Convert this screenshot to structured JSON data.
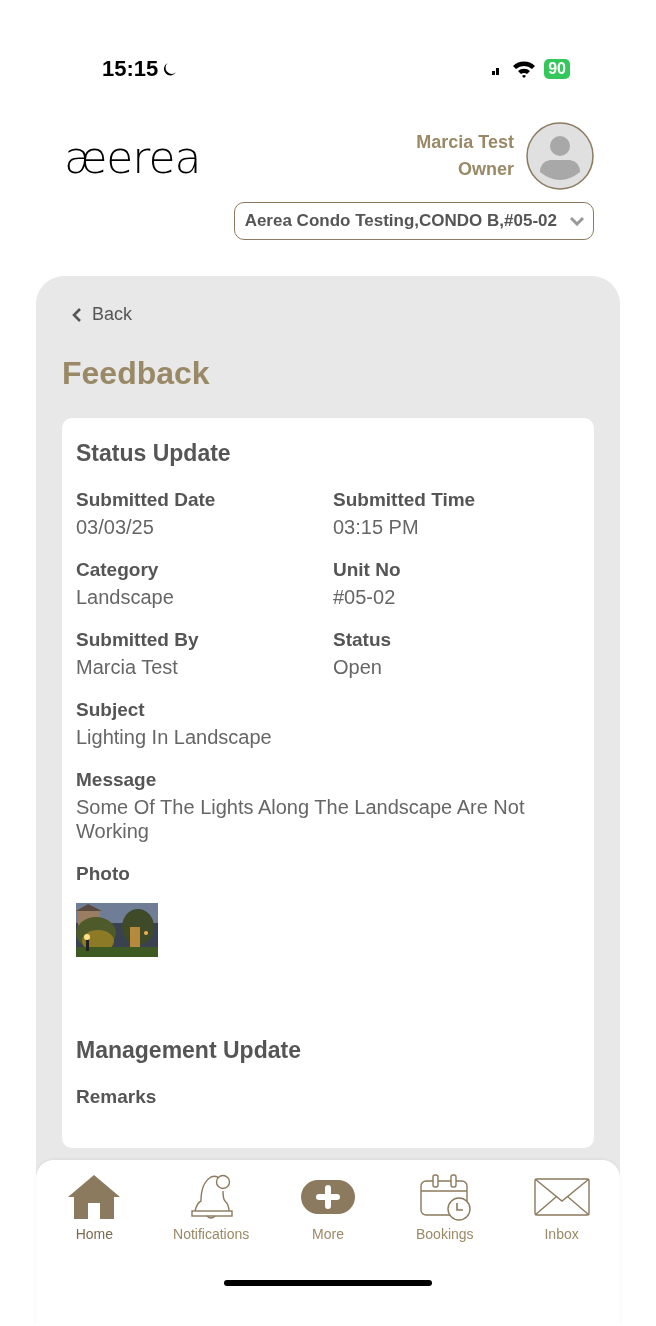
{
  "status_bar": {
    "time": "15:15",
    "battery": "90"
  },
  "header": {
    "logo": "æerea",
    "user_name": "Marcia Test",
    "user_role": "Owner",
    "unit_selector": "Aerea Condo Testing,CONDO B,#05-02"
  },
  "back": "Back",
  "page_title": "Feedback",
  "status_update": {
    "title": "Status Update",
    "fields": [
      {
        "label": "Submitted Date",
        "value": "03/03/25",
        "kind": "half"
      },
      {
        "label": "Submitted Time",
        "value": "03:15 PM",
        "kind": "half"
      },
      {
        "label": "Category",
        "value": "Landscape",
        "kind": "half"
      },
      {
        "label": "Unit No",
        "value": "#05-02",
        "kind": "half"
      },
      {
        "label": "Submitted By",
        "value": "Marcia Test",
        "kind": "half"
      },
      {
        "label": "Status",
        "value": "Open",
        "kind": "half"
      },
      {
        "label": "Subject",
        "value": "Lighting In Landscape",
        "kind": "full"
      },
      {
        "label": "Message",
        "value": "Some Of The Lights Along The Landscape Are Not Working",
        "kind": "full"
      }
    ],
    "photo_label": "Photo"
  },
  "management_update": {
    "title": "Management Update",
    "first_label": "Remarks"
  },
  "tab_bar": [
    {
      "label": "Home",
      "selected": true
    },
    {
      "label": "Notifications",
      "selected": false
    },
    {
      "label": "More",
      "selected": false
    },
    {
      "label": "Bookings",
      "selected": false
    },
    {
      "label": "Inbox",
      "selected": false
    }
  ]
}
